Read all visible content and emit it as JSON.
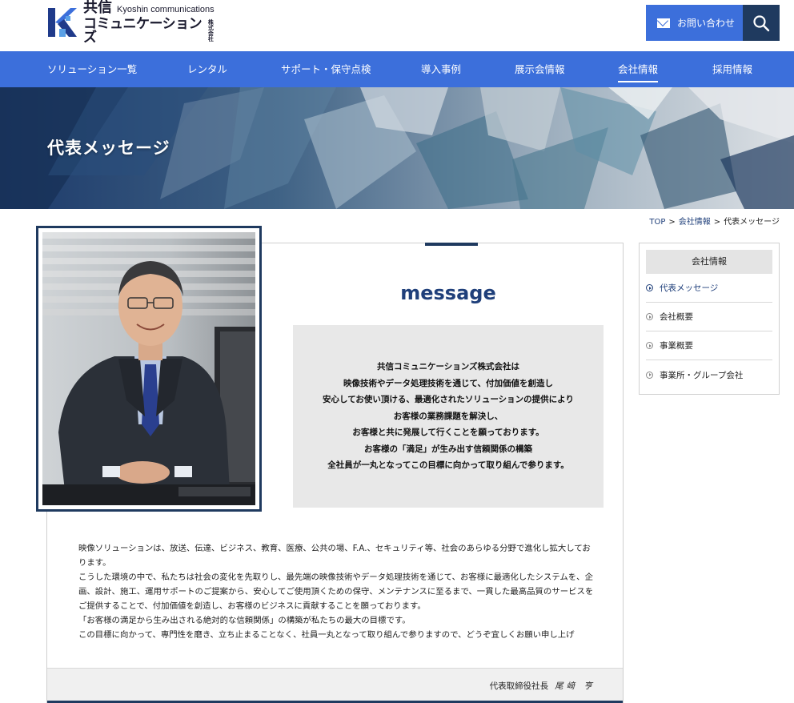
{
  "header": {
    "logo": {
      "kanji": "共信",
      "english": "Kyoshin communications",
      "katakana": "コミュニケーションズ",
      "kk_top": "株式",
      "kk_bottom": "会社"
    },
    "contact_label": "お問い合わせ",
    "icons": {
      "contact": "mail-icon",
      "search": "search-icon"
    }
  },
  "nav": {
    "items": [
      {
        "label": "ソリューション一覧"
      },
      {
        "label": "レンタル"
      },
      {
        "label": "サポート・保守点検"
      },
      {
        "label": "導入事例"
      },
      {
        "label": "展示会情報"
      },
      {
        "label": "会社情報"
      },
      {
        "label": "採用情報"
      }
    ],
    "active_index": 5
  },
  "hero": {
    "title": "代表メッセージ"
  },
  "breadcrumb": {
    "items": [
      "TOP",
      "会社情報",
      "代表メッセージ"
    ],
    "separator": ">"
  },
  "main": {
    "heading": "message",
    "lead_lines": [
      "共信コミュニケーションズ株式会社は",
      "映像技術やデータ処理技術を通じて、付加価値を創造し",
      "安心してお使い頂ける、最適化されたソリューションの提供により",
      "お客様の業務課題を解決し、",
      "お客様と共に発展して行くことを願っております。",
      "お客様の「満足」が生み出す信頼関係の構築",
      "全社員が一丸となってこの目標に向かって取り組んで参ります。"
    ],
    "body_paragraphs": [
      "映像ソリューションは、放送、伝達、ビジネス、教育、医療、公共の場、F.A.、セキュリティ等、社会のあらゆる分野で進化し拡大しております。",
      "こうした環境の中で、私たちは社会の変化を先取りし、最先端の映像技術やデータ処理技術を通じて、お客様に最適化したシステムを、企画、設計、施工、運用サポートのご提案から、安心してご使用頂くための保守、メンテナンスに至るまで、一貫した最高品質のサービスをご提供することで、付加価値を創造し、お客様のビジネスに貢献することを願っております。",
      "「お客様の満足から生み出される絶対的な信頼関係」の構築が私たちの最大の目標です。",
      "この目標に向かって、専門性を磨き、立ち止まることなく、社員一丸となって取り組んで参りますので、どうぞ宜しくお願い申し上げ"
    ],
    "signature_title": "代表取締役社長",
    "signature_name": "尾﨑 亨"
  },
  "sidebar": {
    "title": "会社情報",
    "items": [
      {
        "label": "代表メッセージ"
      },
      {
        "label": "会社概要"
      },
      {
        "label": "事業概要"
      },
      {
        "label": "事業所・グループ会社"
      }
    ],
    "current_index": 0
  },
  "colors": {
    "brand_blue": "#3c6fdb",
    "navy": "#1f3a5f",
    "link": "#1f3f7a",
    "panel_gray": "#e8e8e8"
  }
}
